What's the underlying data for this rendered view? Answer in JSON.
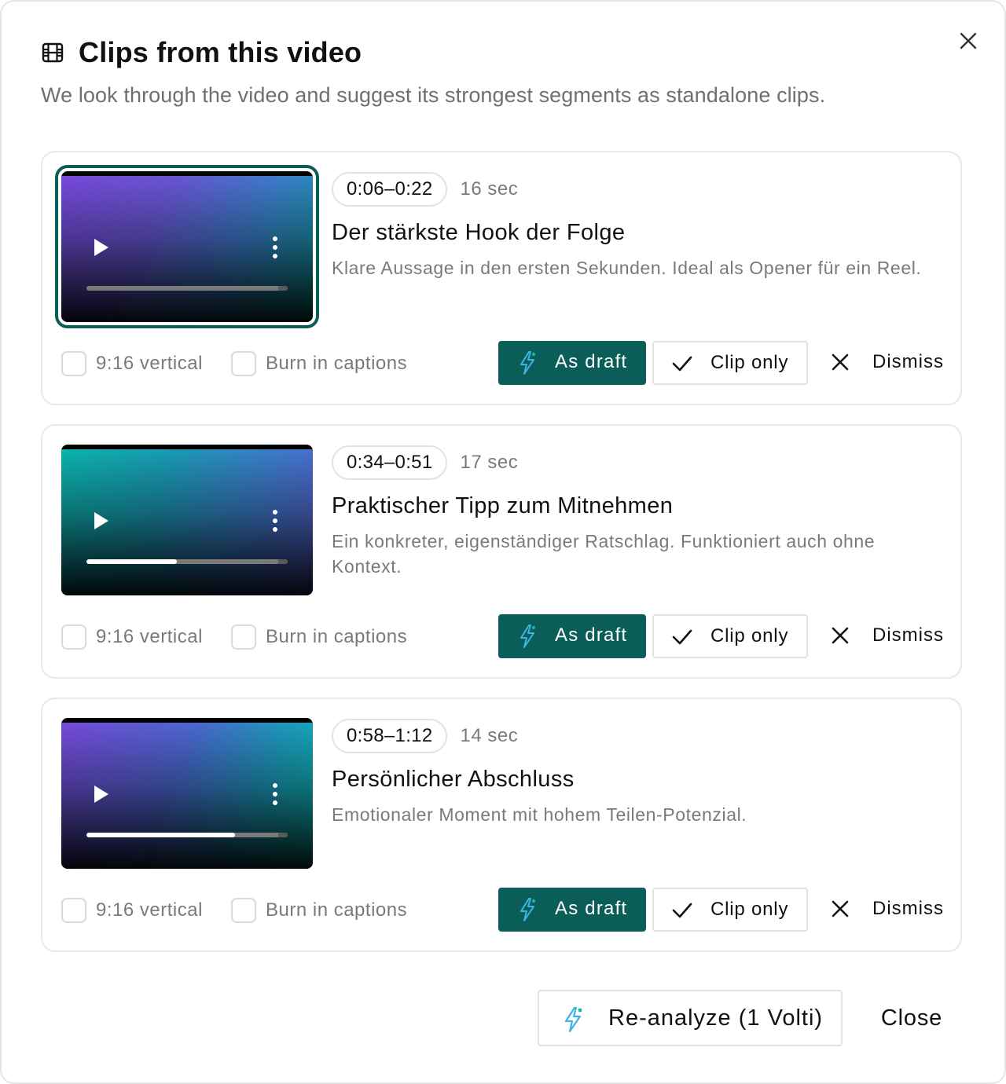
{
  "dialog": {
    "title": "Clips from this video",
    "subtitle": "We look through the video and suggest its strongest segments as standalone clips.",
    "title_icon": "film-icon",
    "close_icon": "close-icon"
  },
  "labels": {
    "vertical": "9:16 vertical",
    "captions": "Burn in captions",
    "as_draft": "As draft",
    "clip_only": "Clip only",
    "dismiss": "Dismiss"
  },
  "colors": {
    "accent": "#0b5d57",
    "lightning": "#3bb4e5"
  },
  "clips": [
    {
      "range": "0:06–0:22",
      "duration": "16 sec",
      "title": "Der stärkste Hook der Folge",
      "description": "Klare Aussage in den ersten Sekunden. Ideal als Opener für ein Reel.",
      "progress": 0.0,
      "selected": true,
      "gradient": "linear-gradient(120deg, #7a4be0 0%, #6a58d8 35%, #3d7fcf 65%, #0aa6a3 100%)"
    },
    {
      "range": "0:34–0:51",
      "duration": "17 sec",
      "title": "Praktischer Tipp zum Mitnehmen",
      "description": "Ein konkreter, eigenständiger Ratschlag. Funktioniert auch ohne Kontext.",
      "progress": 0.45,
      "selected": false,
      "gradient": "linear-gradient(110deg, #0bb8b0 0%, #1a9fb8 35%, #3d7fcf 70%, #5b63d6 100%)"
    },
    {
      "range": "0:58–1:12",
      "duration": "14 sec",
      "title": "Persönlicher Abschluss",
      "description": "Emotionaler Moment mit hohem Teilen-Potenzial.",
      "progress": 0.74,
      "selected": false,
      "gradient": "linear-gradient(110deg, #7a4be0 0%, #4b6bd4 45%, #1d9ec0 75%, #0bbfb3 100%)"
    }
  ],
  "footer": {
    "reanalyze": "Re-analyze (1 Volti)",
    "close": "Close"
  }
}
